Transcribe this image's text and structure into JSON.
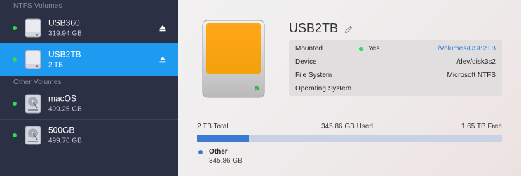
{
  "sidebar": {
    "ntfs_header": "NTFS Volumes",
    "other_header": "Other Volumes",
    "ntfs_volumes": [
      {
        "name": "USB360",
        "size": "319.94 GB"
      },
      {
        "name": "USB2TB",
        "size": "2 TB"
      }
    ],
    "other_volumes": [
      {
        "name": "macOS",
        "size": "499.25 GB"
      },
      {
        "name": "500GB",
        "size": "499.76 GB"
      }
    ]
  },
  "detail": {
    "title": "USB2TB",
    "rows": {
      "mounted_label": "Mounted",
      "mounted_value": "Yes",
      "mount_path": "/Volumes/USB2TB",
      "device_label": "Device",
      "device_value": "/dev/disk3s2",
      "fs_label": "File System",
      "fs_value": "Microsoft NTFS",
      "os_label": "Operating System"
    },
    "usage": {
      "total": "2 TB Total",
      "used": "345.86 GB Used",
      "free": "1.65 TB Free",
      "used_fraction": 0.17
    },
    "legend": {
      "name": "Other",
      "size": "345.86 GB"
    }
  },
  "colors": {
    "sidebar_bg": "#2c3045",
    "selected": "#1e9bf0",
    "status_green": "#2ee04a",
    "bar_fill": "#3c7ad6",
    "bar_track": "#c9d2e4",
    "link": "#2a78d8"
  }
}
